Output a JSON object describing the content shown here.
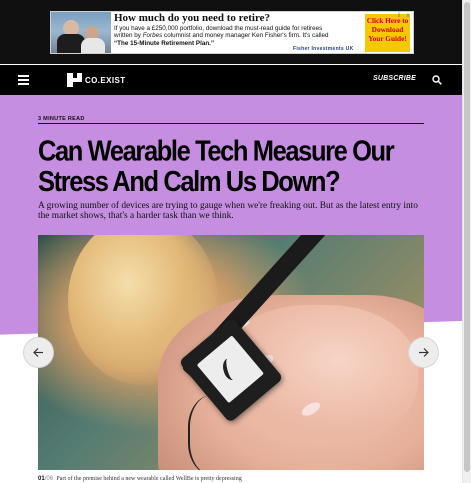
{
  "ad": {
    "headline": "How much do you need to retire?",
    "body_1": "If you have a £250,000 portfolio, download the must-read guide for retirees",
    "body_2a": "written by ",
    "body_2b": "Forbes",
    "body_2c": " columnist and money manager Ken Fisher's firm. It's called",
    "body_3": "“The 15-Minute Retirement Plan.”",
    "footer": "Fisher Investments UK",
    "cta": "Click Here to Download Your Guide!",
    "info_glyph": "i",
    "close_glyph": "x",
    "cta_color": "#f6c800",
    "cta_text_color": "#d80000"
  },
  "nav": {
    "brand": "CO.EXIST",
    "subscribe": "SUBSCRIBE",
    "menu_icon": "hamburger-icon",
    "search_icon": "search-icon"
  },
  "article": {
    "kicker": "3 MINUTE READ",
    "headline": "Can Wearable Tech Measure Our Stress And Calm Us Down?",
    "dek": "A growing number of devices are trying to gauge when we're freaking out. But as the latest entry into the market shows, that's a harder task than we think.",
    "accent_color": "#c58ee0"
  },
  "gallery": {
    "current": "01",
    "total": "/06",
    "caption": "Part of the premise behind a new wearable called WellBe is pretty depressing",
    "prev_icon": "arrow-left-icon",
    "next_icon": "arrow-right-icon"
  }
}
